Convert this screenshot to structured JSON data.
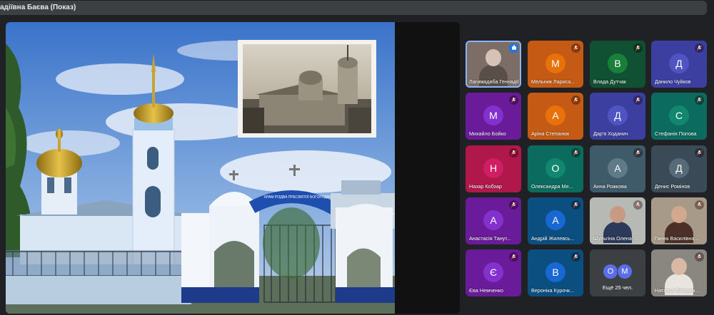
{
  "window": {
    "title": "адіївна Баєва (Показ)"
  },
  "colors": {
    "background": "#202124",
    "title_bar": "#3c4043",
    "speaking_outline": "#8ab4f8"
  },
  "presentation": {
    "label": "Shared screen: church photograph with inset archival photo",
    "sign_text": "ХРАМ РІЗДВА ПРЕСВЯТОЇ БОГОРОДИЦІ"
  },
  "participants": [
    {
      "initial": "",
      "name": "Лагимадиба Геннадії...",
      "bg": "#7c6e66",
      "mic": "speaking",
      "photo": true
    },
    {
      "initial": "М",
      "name": "Мельник Лариса...",
      "bg": "#c45a14",
      "avatar": "#e8710a",
      "mic": "muted"
    },
    {
      "initial": "В",
      "name": "Влада Дутчак",
      "bg": "#0f5132",
      "avatar": "#188038",
      "mic": "muted"
    },
    {
      "initial": "Д",
      "name": "Данило Чуйков",
      "bg": "#3c3fa0",
      "avatar": "#4f54c2",
      "mic": "muted"
    },
    {
      "initial": "М",
      "name": "Михайло Бойко",
      "bg": "#6a1b9a",
      "avatar": "#8430ce",
      "mic": "muted"
    },
    {
      "initial": "А",
      "name": "Аріна Степанюк",
      "bg": "#c45a14",
      "avatar": "#e8710a",
      "mic": "muted"
    },
    {
      "initial": "Д",
      "name": "Дар'я Ходанич",
      "bg": "#3c3fa0",
      "avatar": "#4f54c2",
      "mic": "muted"
    },
    {
      "initial": "С",
      "name": "Стефанія Попова",
      "bg": "#0b6b5e",
      "avatar": "#12876f",
      "mic": "muted"
    },
    {
      "initial": "Н",
      "name": "Назар Кобзар",
      "bg": "#b0174b",
      "avatar": "#d01e64",
      "mic": "muted"
    },
    {
      "initial": "О",
      "name": "Олександра Ме...",
      "bg": "#0b6b5e",
      "avatar": "#12876f",
      "mic": "muted"
    },
    {
      "initial": "А",
      "name": "Анна Рожкова",
      "bg": "#3f5a68",
      "avatar": "#5f7a88",
      "mic": "muted"
    },
    {
      "initial": "Д",
      "name": "Денис Ромінов",
      "bg": "#3a4a56",
      "avatar": "#566a78",
      "mic": "muted"
    },
    {
      "initial": "А",
      "name": "Анастасія Танут...",
      "bg": "#6a1b9a",
      "avatar": "#8430ce",
      "mic": "muted"
    },
    {
      "initial": "А",
      "name": "Андрій Жилевсь...",
      "bg": "#0a4f80",
      "avatar": "#1967d2",
      "mic": "muted"
    },
    {
      "initial": "",
      "name": "Шульгіна Олена ...",
      "bg": "#b7b9b4",
      "mic": "muted",
      "photo": true,
      "skin": "#c89a82",
      "shirt": "#2b3a5a"
    },
    {
      "initial": "",
      "name": "Ганна Василівна...",
      "bg": "#a89a88",
      "mic": "muted",
      "photo": true,
      "skin": "#d2a88f",
      "shirt": "#4a3026"
    },
    {
      "initial": "Є",
      "name": "Єва Немченко",
      "bg": "#6a1b9a",
      "avatar": "#8430ce",
      "mic": "muted"
    },
    {
      "initial": "В",
      "name": "Вероніка Курочк...",
      "bg": "#0a4f80",
      "avatar": "#1967d2",
      "mic": "muted"
    },
    {
      "more": true,
      "initials": [
        "О",
        "М"
      ],
      "label": "Ещё 25 чел."
    },
    {
      "initial": "",
      "name": "Наталья Владим...",
      "bg": "#8a8680",
      "mic": "muted",
      "photo": true,
      "skin": "#d9b8a4",
      "shirt": "#e8e4df"
    }
  ]
}
